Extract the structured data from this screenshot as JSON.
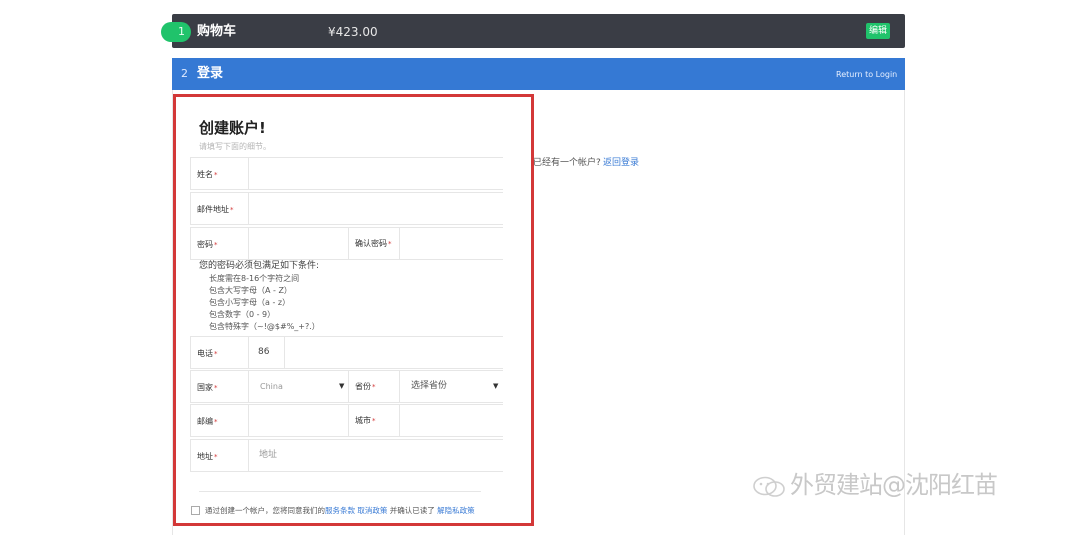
{
  "step1": {
    "number": "1",
    "title": "购物车",
    "amount": "¥423.00",
    "edit_label": "编辑"
  },
  "step2": {
    "number": "2",
    "title": "登录",
    "return_label": "Return to Login"
  },
  "form": {
    "title": "创建账户!",
    "subtitle": "请填写下面的细节。",
    "name_label": "姓名",
    "email_label": "邮件地址",
    "password_label": "密码",
    "confirm_password_label": "确认密码",
    "password_rules_heading": "您的密码必须包满足如下条件:",
    "password_rules": [
      "长度需在8-16个字符之间",
      "包含大写字母（A - Z）",
      "包含小写字母（a - z）",
      "包含数字（0 - 9）",
      "包含特殊字（~!@$#%_+?.）"
    ],
    "phone_label": "电话",
    "phone_code": "86",
    "country_label": "国家",
    "country_value": "China",
    "province_label": "省份",
    "province_placeholder": "选择省份",
    "zip_label": "邮编",
    "city_label": "城市",
    "address_label": "地址",
    "address_placeholder": "地址",
    "required_mark": "*"
  },
  "existing_account": {
    "text": "已经有一个帐户?",
    "link": "返回登录"
  },
  "agreement": {
    "prefix": "通过创建一个帐户，您将同意我们的",
    "terms_link": "服务条款",
    "cancel_link": "取消政策",
    "middle": "并确认已读了",
    "privacy_link": "解隐私政策"
  },
  "watermark": {
    "text": "外贸建站@沈阳红苗"
  }
}
